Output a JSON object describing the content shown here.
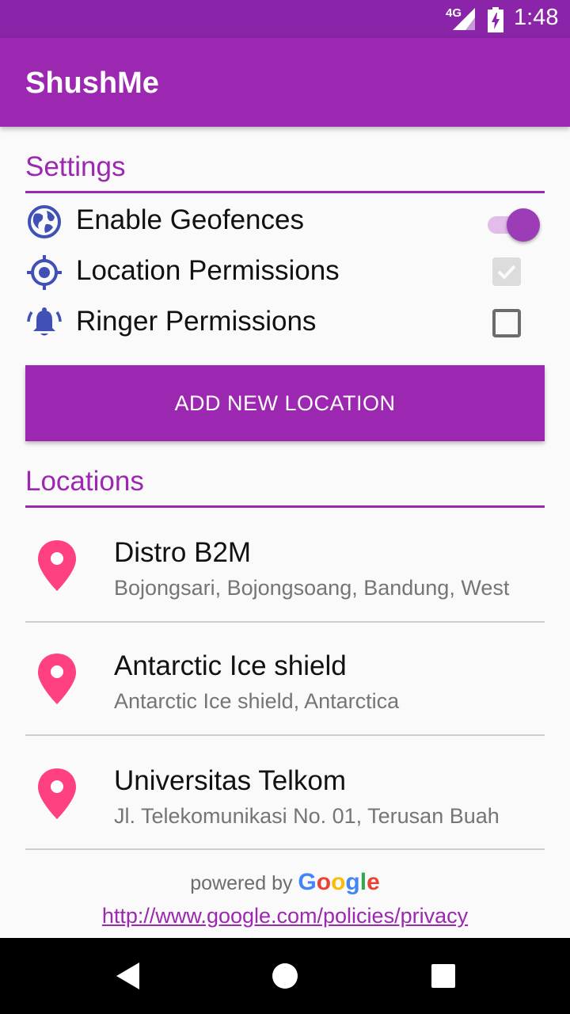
{
  "status_bar": {
    "network": "4G",
    "time": "1:48",
    "icons": [
      "signal-icon",
      "battery-charging-icon"
    ]
  },
  "app_bar": {
    "title": "ShushMe"
  },
  "settings": {
    "title": "Settings",
    "rows": [
      {
        "label": "Enable Geofences",
        "icon": "globe-icon",
        "control": "switch",
        "state": true
      },
      {
        "label": "Location Permissions",
        "icon": "gps-fixed-icon",
        "control": "checkbox",
        "state": true
      },
      {
        "label": "Ringer Permissions",
        "icon": "ringer-bell-icon",
        "control": "checkbox",
        "state": false
      }
    ],
    "add_button_label": "ADD NEW LOCATION"
  },
  "locations": {
    "title": "Locations",
    "items": [
      {
        "name": "Distro B2M",
        "address": "Bojongsari, Bojongsoang, Bandung, West"
      },
      {
        "name": "Antarctic Ice shield",
        "address": "Antarctic Ice shield, Antarctica"
      },
      {
        "name": "Universitas Telkom",
        "address": "Jl. Telekomunikasi No. 01, Terusan Buah"
      }
    ]
  },
  "footer": {
    "powered_by": "powered by",
    "google_letters": [
      "G",
      "o",
      "o",
      "g",
      "l",
      "e"
    ],
    "google_colors": [
      "#4285F4",
      "#EA4335",
      "#FBBC05",
      "#4285F4",
      "#34A853",
      "#EA4335"
    ],
    "privacy_link": "http://www.google.com/policies/privacy"
  },
  "colors": {
    "primary": "#9c27b0",
    "primary_dark": "#8a24a8",
    "icon_blue": "#3f51b5",
    "pin_pink": "#ff4081"
  },
  "nav_bar": {
    "icons": [
      "back-icon",
      "home-icon",
      "recents-icon"
    ]
  }
}
